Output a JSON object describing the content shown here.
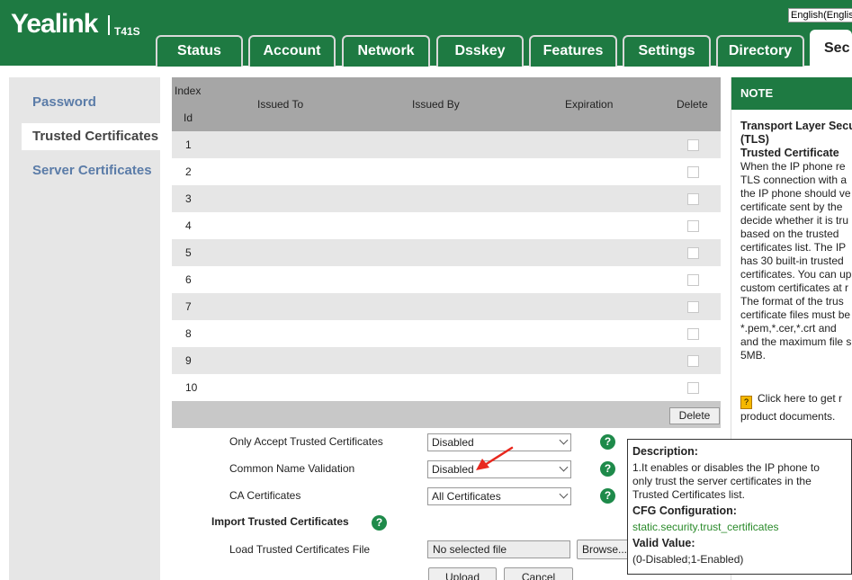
{
  "header": {
    "logo": "Yealink",
    "model": "T41S",
    "language": "English(English)",
    "tabs": [
      "Status",
      "Account",
      "Network",
      "Dsskey",
      "Features",
      "Settings",
      "Directory",
      "Security"
    ],
    "active_tab": "Security"
  },
  "sidebar": {
    "items": [
      {
        "label": "Password"
      },
      {
        "label": "Trusted Certificates"
      },
      {
        "label": "Server Certificates"
      }
    ],
    "active": "Trusted Certificates"
  },
  "table": {
    "headers": {
      "index": "Index",
      "id": "Id",
      "issued_to": "Issued To",
      "issued_by": "Issued By",
      "expiration": "Expiration",
      "delete": "Delete"
    },
    "rows": [
      "1",
      "2",
      "3",
      "4",
      "5",
      "6",
      "7",
      "8",
      "9",
      "10"
    ],
    "delete_button": "Delete"
  },
  "form": {
    "only_accept": {
      "label": "Only Accept Trusted Certificates",
      "value": "Disabled"
    },
    "common_name": {
      "label": "Common Name Validation",
      "value": "Disabled"
    },
    "ca_certificates": {
      "label": "CA Certificates",
      "value": "All Certificates"
    },
    "import_heading": "Import Trusted Certificates",
    "load_file": {
      "label": "Load Trusted Certificates File",
      "value": "No selected file",
      "browse": "Browse..."
    },
    "upload": "Upload",
    "cancel": "Cancel"
  },
  "note": {
    "title": "NOTE",
    "heading1": "Transport Layer Secu",
    "heading2": "(TLS)",
    "heading3": "Trusted Certificate",
    "lines": [
      "When the IP phone re",
      "TLS connection with a",
      "the IP phone should ve",
      "certificate sent by the",
      "decide whether it is tru",
      "based on the trusted",
      "certificates list. The IP",
      "has 30 built-in trusted",
      "certificates. You can up",
      "custom certificates at r",
      "The format of the trus",
      "certificate files must be",
      "*.pem,*.cer,*.crt and",
      "and the maximum file s",
      "5MB."
    ],
    "link_line1": "Click here to get r",
    "link_line2": "product documents."
  },
  "tooltip": {
    "desc_label": "Description:",
    "desc_lines": [
      "1.It enables or disables the IP phone to",
      "only trust the server certificates in the",
      "Trusted Certificates list."
    ],
    "cfg_label": "CFG Configuration:",
    "cfg_value": "static.security.trust_certificates",
    "valid_label": "Valid Value:",
    "valid_value": "(0-Disabled;1-Enabled)"
  },
  "colors": {
    "brand_green": "#1e7a42",
    "help_green": "#1e8a4a",
    "arrow_red": "#e8281e",
    "link_blue": "#5b7ca8"
  },
  "icons": [
    "help-icon",
    "document-icon",
    "chevron-down-icon",
    "annotation-arrow-icon"
  ]
}
